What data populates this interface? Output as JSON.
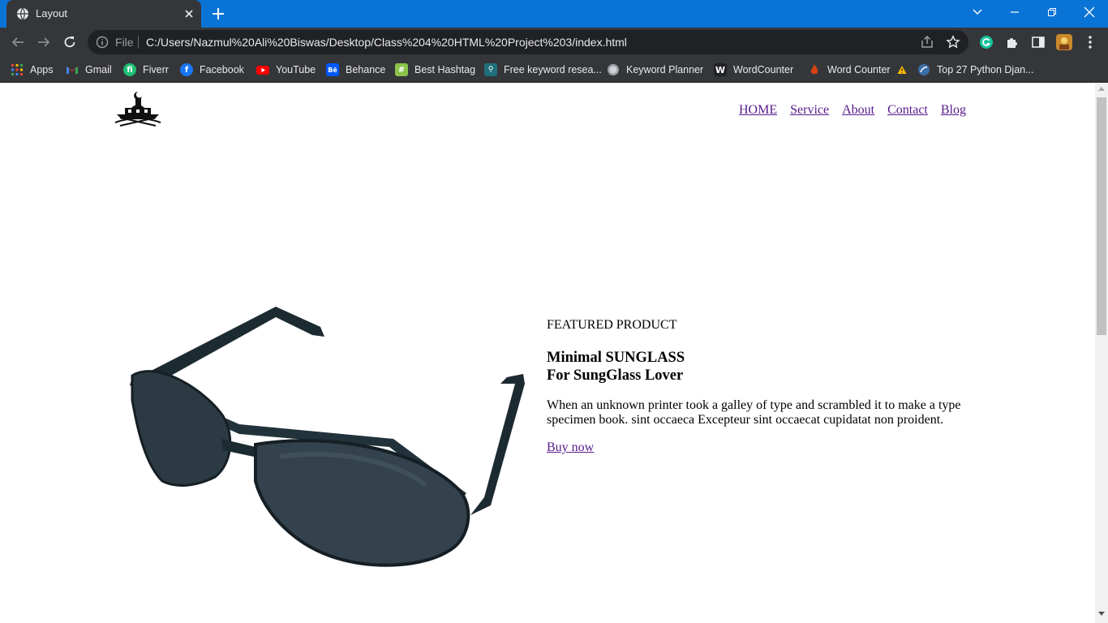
{
  "browser": {
    "tab_title": "Layout",
    "omnibox_scheme": "File",
    "url": "C:/Users/Nazmul%20Ali%20Biswas/Desktop/Class%204%20HTML%20Project%203/index.html",
    "accent_color": "#0a74d6"
  },
  "bookmarks": [
    {
      "label": "Apps",
      "icon": "apps-grid-icon"
    },
    {
      "label": "Gmail",
      "icon": "gmail-icon"
    },
    {
      "label": "Fiverr",
      "icon": "fiverr-icon"
    },
    {
      "label": "Facebook",
      "icon": "facebook-icon"
    },
    {
      "label": "YouTube",
      "icon": "youtube-icon"
    },
    {
      "label": "Behance",
      "icon": "behance-icon"
    },
    {
      "label": "Best Hashtag",
      "icon": "hashtag-icon"
    },
    {
      "label": "Free keyword resea...",
      "icon": "keyword-research-icon"
    },
    {
      "label": "Keyword Planner",
      "icon": "globe-icon"
    },
    {
      "label": "WordCounter",
      "icon": "w-icon"
    },
    {
      "label": "Word Counter",
      "icon": "flame-icon"
    },
    {
      "label": "Top 27 Python Djan...",
      "icon": "link-icon"
    }
  ],
  "page": {
    "nav": [
      "HOME",
      "Service",
      "About",
      "Contact",
      "Blog"
    ],
    "featured_label": "FEATURED PRODUCT",
    "headline_line1": "Minimal SUNGLASS",
    "headline_line2": "For SungGlass Lover",
    "description": "When an unknown printer took a galley of type and scrambled it to make a type specimen book. sint occaeca Excepteur sint occaecat cupidatat non proident.",
    "cta": "Buy now",
    "link_color": "#551a8b"
  }
}
